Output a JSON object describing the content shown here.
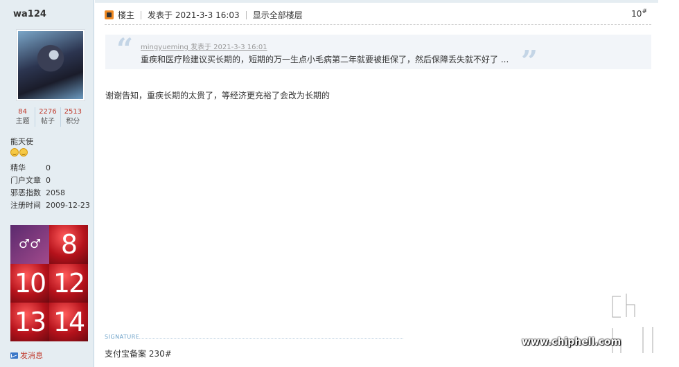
{
  "user": {
    "name": "wa124",
    "stats": [
      {
        "value": "84",
        "label": "主题"
      },
      {
        "value": "2276",
        "label": "帖子"
      },
      {
        "value": "2513",
        "label": "积分"
      }
    ],
    "group": "能天使",
    "profile": [
      {
        "key": "精华",
        "value": "0"
      },
      {
        "key": "门户文章",
        "value": "0"
      },
      {
        "key": "邪恶指数",
        "value": "2058"
      },
      {
        "key": "注册时间",
        "value": "2009-12-23"
      }
    ],
    "medals": [
      "♂♂",
      "8",
      "10",
      "12",
      "13",
      "14"
    ],
    "send_message": "发消息"
  },
  "post": {
    "author_tag": "楼主",
    "posted_at": "发表于 2021-3-3 16:03",
    "show_all": "显示全部楼层",
    "floor": "10",
    "floor_suffix": "#",
    "quote": {
      "author_line": "mingyueming 发表于 2021-3-3 16:01",
      "text": "重疾和医疗险建议买长期的，短期的万一生点小毛病第二年就要被拒保了，然后保障丢失就不好了 ..."
    },
    "message": "谢谢告知，重疾长期的太贵了，等经济更充裕了会改为长期的",
    "signature_label": "SIGNATURE",
    "signature": "支付宝备案 230#"
  },
  "watermark": {
    "url": "www.chiphell.com",
    "logo_text": "chip hell"
  },
  "colors": {
    "sidebar_bg": "#e5edf2",
    "accent_red": "#c0392b",
    "quote_bg": "#f2f5f9"
  }
}
